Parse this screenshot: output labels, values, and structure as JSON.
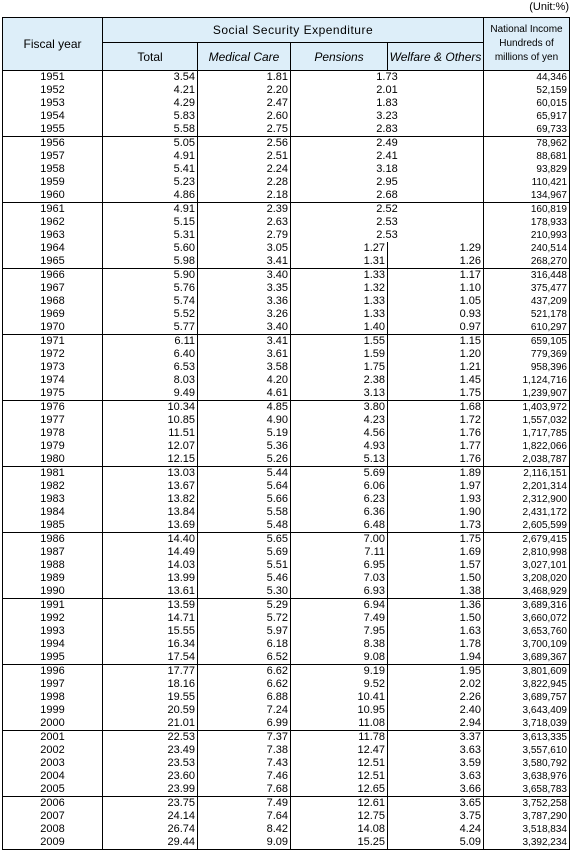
{
  "unit_label": "(Unit:%)",
  "header": {
    "fiscal_year": "Fiscal year",
    "group_title": "Social  Security  Expenditure",
    "total": "Total",
    "medical_care": "Medical Care",
    "pensions": "Pensions",
    "welfare_others": "Welfare & Others",
    "national_income_line1": "National Income",
    "national_income_line2": "Hundreds of",
    "national_income_line3": "millions of yen"
  },
  "rows": [
    {
      "year": "1951",
      "total": "3.54",
      "medical": "1.81",
      "pensions_welfare": "1.73",
      "national_income": "44,346"
    },
    {
      "year": "1952",
      "total": "4.21",
      "medical": "2.20",
      "pensions_welfare": "2.01",
      "national_income": "52,159"
    },
    {
      "year": "1953",
      "total": "4.29",
      "medical": "2.47",
      "pensions_welfare": "1.83",
      "national_income": "60,015"
    },
    {
      "year": "1954",
      "total": "5.83",
      "medical": "2.60",
      "pensions_welfare": "3.23",
      "national_income": "65,917"
    },
    {
      "year": "1955",
      "total": "5.58",
      "medical": "2.75",
      "pensions_welfare": "2.83",
      "national_income": "69,733"
    },
    {
      "year": "1956",
      "total": "5.05",
      "medical": "2.56",
      "pensions_welfare": "2.49",
      "national_income": "78,962"
    },
    {
      "year": "1957",
      "total": "4.91",
      "medical": "2.51",
      "pensions_welfare": "2.41",
      "national_income": "88,681"
    },
    {
      "year": "1958",
      "total": "5.41",
      "medical": "2.24",
      "pensions_welfare": "3.18",
      "national_income": "93,829"
    },
    {
      "year": "1959",
      "total": "5.23",
      "medical": "2.28",
      "pensions_welfare": "2.95",
      "national_income": "110,421"
    },
    {
      "year": "1960",
      "total": "4.86",
      "medical": "2.18",
      "pensions_welfare": "2.68",
      "national_income": "134,967"
    },
    {
      "year": "1961",
      "total": "4.91",
      "medical": "2.39",
      "pensions_welfare": "2.52",
      "national_income": "160,819"
    },
    {
      "year": "1962",
      "total": "5.15",
      "medical": "2.63",
      "pensions_welfare": "2.53",
      "national_income": "178,933"
    },
    {
      "year": "1963",
      "total": "5.31",
      "medical": "2.79",
      "pensions_welfare": "2.53",
      "national_income": "210,993"
    },
    {
      "year": "1964",
      "total": "5.60",
      "medical": "3.05",
      "pensions": "1.27",
      "welfare": "1.29",
      "national_income": "240,514"
    },
    {
      "year": "1965",
      "total": "5.98",
      "medical": "3.41",
      "pensions": "1.31",
      "welfare": "1.26",
      "national_income": "268,270"
    },
    {
      "year": "1966",
      "total": "5.90",
      "medical": "3.40",
      "pensions": "1.33",
      "welfare": "1.17",
      "national_income": "316,448"
    },
    {
      "year": "1967",
      "total": "5.76",
      "medical": "3.35",
      "pensions": "1.32",
      "welfare": "1.10",
      "national_income": "375,477"
    },
    {
      "year": "1968",
      "total": "5.74",
      "medical": "3.36",
      "pensions": "1.33",
      "welfare": "1.05",
      "national_income": "437,209"
    },
    {
      "year": "1969",
      "total": "5.52",
      "medical": "3.26",
      "pensions": "1.33",
      "welfare": "0.93",
      "national_income": "521,178"
    },
    {
      "year": "1970",
      "total": "5.77",
      "medical": "3.40",
      "pensions": "1.40",
      "welfare": "0.97",
      "national_income": "610,297"
    },
    {
      "year": "1971",
      "total": "6.11",
      "medical": "3.41",
      "pensions": "1.55",
      "welfare": "1.15",
      "national_income": "659,105"
    },
    {
      "year": "1972",
      "total": "6.40",
      "medical": "3.61",
      "pensions": "1.59",
      "welfare": "1.20",
      "national_income": "779,369"
    },
    {
      "year": "1973",
      "total": "6.53",
      "medical": "3.58",
      "pensions": "1.75",
      "welfare": "1.21",
      "national_income": "958,396"
    },
    {
      "year": "1974",
      "total": "8.03",
      "medical": "4.20",
      "pensions": "2.38",
      "welfare": "1.45",
      "national_income": "1,124,716"
    },
    {
      "year": "1975",
      "total": "9.49",
      "medical": "4.61",
      "pensions": "3.13",
      "welfare": "1.75",
      "national_income": "1,239,907"
    },
    {
      "year": "1976",
      "total": "10.34",
      "medical": "4.85",
      "pensions": "3.80",
      "welfare": "1.68",
      "national_income": "1,403,972"
    },
    {
      "year": "1977",
      "total": "10.85",
      "medical": "4.90",
      "pensions": "4.23",
      "welfare": "1.72",
      "national_income": "1,557,032"
    },
    {
      "year": "1978",
      "total": "11.51",
      "medical": "5.19",
      "pensions": "4.56",
      "welfare": "1.76",
      "national_income": "1,717,785"
    },
    {
      "year": "1979",
      "total": "12.07",
      "medical": "5.36",
      "pensions": "4.93",
      "welfare": "1.77",
      "national_income": "1,822,066"
    },
    {
      "year": "1980",
      "total": "12.15",
      "medical": "5.26",
      "pensions": "5.13",
      "welfare": "1.76",
      "national_income": "2,038,787"
    },
    {
      "year": "1981",
      "total": "13.03",
      "medical": "5.44",
      "pensions": "5.69",
      "welfare": "1.89",
      "national_income": "2,116,151"
    },
    {
      "year": "1982",
      "total": "13.67",
      "medical": "5.64",
      "pensions": "6.06",
      "welfare": "1.97",
      "national_income": "2,201,314"
    },
    {
      "year": "1983",
      "total": "13.82",
      "medical": "5.66",
      "pensions": "6.23",
      "welfare": "1.93",
      "national_income": "2,312,900"
    },
    {
      "year": "1984",
      "total": "13.84",
      "medical": "5.58",
      "pensions": "6.36",
      "welfare": "1.90",
      "national_income": "2,431,172"
    },
    {
      "year": "1985",
      "total": "13.69",
      "medical": "5.48",
      "pensions": "6.48",
      "welfare": "1.73",
      "national_income": "2,605,599"
    },
    {
      "year": "1986",
      "total": "14.40",
      "medical": "5.65",
      "pensions": "7.00",
      "welfare": "1.75",
      "national_income": "2,679,415"
    },
    {
      "year": "1987",
      "total": "14.49",
      "medical": "5.69",
      "pensions": "7.11",
      "welfare": "1.69",
      "national_income": "2,810,998"
    },
    {
      "year": "1988",
      "total": "14.03",
      "medical": "5.51",
      "pensions": "6.95",
      "welfare": "1.57",
      "national_income": "3,027,101"
    },
    {
      "year": "1989",
      "total": "13.99",
      "medical": "5.46",
      "pensions": "7.03",
      "welfare": "1.50",
      "national_income": "3,208,020"
    },
    {
      "year": "1990",
      "total": "13.61",
      "medical": "5.30",
      "pensions": "6.93",
      "welfare": "1.38",
      "national_income": "3,468,929"
    },
    {
      "year": "1991",
      "total": "13.59",
      "medical": "5.29",
      "pensions": "6.94",
      "welfare": "1.36",
      "national_income": "3,689,316"
    },
    {
      "year": "1992",
      "total": "14.71",
      "medical": "5.72",
      "pensions": "7.49",
      "welfare": "1.50",
      "national_income": "3,660,072"
    },
    {
      "year": "1993",
      "total": "15.55",
      "medical": "5.97",
      "pensions": "7.95",
      "welfare": "1.63",
      "national_income": "3,653,760"
    },
    {
      "year": "1994",
      "total": "16.34",
      "medical": "6.18",
      "pensions": "8.38",
      "welfare": "1.78",
      "national_income": "3,700,109"
    },
    {
      "year": "1995",
      "total": "17.54",
      "medical": "6.52",
      "pensions": "9.08",
      "welfare": "1.94",
      "national_income": "3,689,367"
    },
    {
      "year": "1996",
      "total": "17.77",
      "medical": "6.62",
      "pensions": "9.19",
      "welfare": "1.95",
      "national_income": "3,801,609"
    },
    {
      "year": "1997",
      "total": "18.16",
      "medical": "6.62",
      "pensions": "9.52",
      "welfare": "2.02",
      "national_income": "3,822,945"
    },
    {
      "year": "1998",
      "total": "19.55",
      "medical": "6.88",
      "pensions": "10.41",
      "welfare": "2.26",
      "national_income": "3,689,757"
    },
    {
      "year": "1999",
      "total": "20.59",
      "medical": "7.24",
      "pensions": "10.95",
      "welfare": "2.40",
      "national_income": "3,643,409"
    },
    {
      "year": "2000",
      "total": "21.01",
      "medical": "6.99",
      "pensions": "11.08",
      "welfare": "2.94",
      "national_income": "3,718,039"
    },
    {
      "year": "2001",
      "total": "22.53",
      "medical": "7.37",
      "pensions": "11.78",
      "welfare": "3.37",
      "national_income": "3,613,335"
    },
    {
      "year": "2002",
      "total": "23.49",
      "medical": "7.38",
      "pensions": "12.47",
      "welfare": "3.63",
      "national_income": "3,557,610"
    },
    {
      "year": "2003",
      "total": "23.53",
      "medical": "7.43",
      "pensions": "12.51",
      "welfare": "3.59",
      "national_income": "3,580,792"
    },
    {
      "year": "2004",
      "total": "23.60",
      "medical": "7.46",
      "pensions": "12.51",
      "welfare": "3.63",
      "national_income": "3,638,976"
    },
    {
      "year": "2005",
      "total": "23.99",
      "medical": "7.68",
      "pensions": "12.65",
      "welfare": "3.66",
      "national_income": "3,658,783"
    },
    {
      "year": "2006",
      "total": "23.75",
      "medical": "7.49",
      "pensions": "12.61",
      "welfare": "3.65",
      "national_income": "3,752,258"
    },
    {
      "year": "2007",
      "total": "24.14",
      "medical": "7.64",
      "pensions": "12.75",
      "welfare": "3.75",
      "national_income": "3,787,290"
    },
    {
      "year": "2008",
      "total": "26.74",
      "medical": "8.42",
      "pensions": "14.08",
      "welfare": "4.24",
      "national_income": "3,518,834"
    },
    {
      "year": "2009",
      "total": "29.44",
      "medical": "9.09",
      "pensions": "15.25",
      "welfare": "5.09",
      "national_income": "3,392,234"
    }
  ]
}
